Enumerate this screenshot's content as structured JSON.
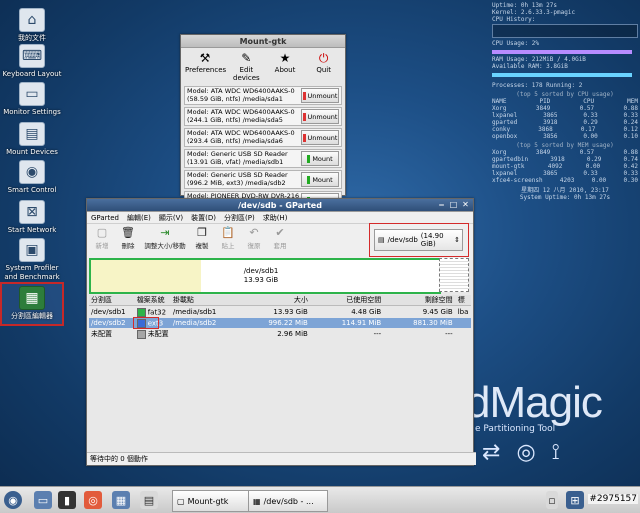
{
  "desktop": {
    "icons": [
      {
        "label": "我的文件",
        "icon": "home-icon"
      },
      {
        "label": "Keyboard Layout",
        "icon": "keyboard-icon"
      },
      {
        "label": "Monitor Settings",
        "icon": "monitor-icon"
      },
      {
        "label": "Mount Devices",
        "icon": "drive-icon"
      },
      {
        "label": "Smart Control",
        "icon": "disk-icon"
      },
      {
        "label": "Start Network",
        "icon": "network-icon"
      },
      {
        "label": "System Profiler and Benchmark",
        "icon": "chip-icon"
      },
      {
        "label": "分割區編輯器",
        "icon": "partition-editor-icon"
      }
    ],
    "brand": {
      "big": "dMagic",
      "sub": "e Partitioning Tool"
    }
  },
  "mount_gtk": {
    "title": "Mount-gtk",
    "toolbar": {
      "preferences": "Preferences",
      "edit": "Edit devices",
      "about": "About",
      "quit": "Quit"
    },
    "drives": [
      {
        "line1": "Model: ATA WDC WD6400AAKS-0",
        "line2": "(58.59 GiB, ntfs)  /media/sda1",
        "action": "Unmount",
        "led": "#d33"
      },
      {
        "line1": "Model: ATA WDC WD6400AAKS-0",
        "line2": "(244.1 GiB, ntfs)  /media/sda5",
        "action": "Unmount",
        "led": "#d33"
      },
      {
        "line1": "Model: ATA WDC WD6400AAKS-0",
        "line2": "(293.4 GiB, ntfs)  /media/sda6",
        "action": "Unmount",
        "led": "#d33"
      },
      {
        "line1": "Model: Generic USB SD Reader",
        "line2": "(13.91 GiB, vfat)  /media/sdb1",
        "action": "Mount",
        "led": "#2a2"
      },
      {
        "line1": "Model: Generic USB SD Reader",
        "line2": "(996.2 MiB, ext3)  /media/sdb2",
        "action": "Mount",
        "led": "#2a2"
      },
      {
        "line1": "Model: PIONEER DVD-RW  DVR-216",
        "line2": "/media/cdrom1",
        "action": "Mount",
        "led": "#2a2"
      }
    ]
  },
  "gparted": {
    "title": "/dev/sdb - GParted",
    "menu": [
      "GParted",
      "編輯(E)",
      "顯示(V)",
      "裝置(D)",
      "分割區(P)",
      "求助(H)"
    ],
    "toolbar": [
      {
        "label": "新增",
        "icon": "new-icon",
        "disabled": true
      },
      {
        "label": "刪除",
        "icon": "delete-icon",
        "disabled": false
      },
      {
        "label": "調整大小/移動",
        "icon": "resize-icon",
        "disabled": false
      },
      {
        "label": "複製",
        "icon": "copy-icon",
        "disabled": false
      },
      {
        "label": "貼上",
        "icon": "paste-icon",
        "disabled": true
      },
      {
        "label": "復原",
        "icon": "undo-icon",
        "disabled": true
      },
      {
        "label": "套用",
        "icon": "apply-icon",
        "disabled": true
      }
    ],
    "device": {
      "name": "/dev/sdb",
      "size": "(14.90 GiB)"
    },
    "map": {
      "label1": "/dev/sdb1",
      "label2": "13.93 GiB"
    },
    "columns": [
      "分割區",
      "檔案系統",
      "掛載點",
      "大小",
      "已使用空間",
      "剩餘空間",
      "標"
    ],
    "rows": [
      {
        "part": "/dev/sdb1",
        "fs": "fat32",
        "fs_color": "#2db34a",
        "mount": "/media/sdb1",
        "size": "13.93 GiB",
        "used": "4.48 GiB",
        "free": "9.45 GiB",
        "flag": "lba"
      },
      {
        "part": "/dev/sdb2",
        "fs": "ext3",
        "fs_color": "#3b6bd6",
        "mount": "/media/sdb2",
        "size": "996.22 MiB",
        "used": "114.91 MiB",
        "free": "881.30 MiB",
        "flag": ""
      },
      {
        "part": "未配置",
        "fs": "未配置",
        "fs_color": "#a6a6a6",
        "mount": "",
        "size": "2.96 MiB",
        "used": "---",
        "free": "---",
        "flag": ""
      }
    ],
    "status": "等待中的 0 個動作"
  },
  "conky": {
    "lines": [
      "Uptime: 0h 13m 27s",
      "Kernel: 2.6.33.3-pmagic",
      "CPU History:",
      "CPU Usage: 2%",
      "RAM Usage: 212MiB / 4.0GiB",
      "Available RAM: 3.8GiB"
    ],
    "processes": "Processes: 178   Running: 2",
    "cpu_hdr": "(top 5 sorted by CPU usage)",
    "cpu_cols": [
      "NAME",
      "PID",
      "CPU",
      "MEM"
    ],
    "cpu_rows": [
      [
        "Xorg",
        "3849",
        "0.57",
        "0.88"
      ],
      [
        "lxpanel",
        "3865",
        "0.33",
        "0.33"
      ],
      [
        "gparted",
        "3918",
        "0.29",
        "0.24"
      ],
      [
        "conky",
        "3868",
        "0.17",
        "0.12"
      ],
      [
        "openbox",
        "3856",
        "0.00",
        "0.10"
      ]
    ],
    "mem_hdr": "(top 5 sorted by MEM usage)",
    "mem_rows": [
      [
        "Xorg",
        "3849",
        "0.57",
        "0.88"
      ],
      [
        "gpartedbin",
        "3918",
        "0.29",
        "0.74"
      ],
      [
        "mount-gtk",
        "4092",
        "0.00",
        "0.42"
      ],
      [
        "lxpanel",
        "3865",
        "0.33",
        "0.33"
      ],
      [
        "xfce4-screensh",
        "4203",
        "0.00",
        "0.30"
      ]
    ],
    "footer1": "星期四 12 八月 2010, 23:17",
    "footer2": "System Uptime: 0h 13m 27s"
  },
  "taskbar": {
    "tasks": [
      "Mount-gtk",
      "/dev/sdb - ..."
    ],
    "watermark": "#2975157"
  }
}
